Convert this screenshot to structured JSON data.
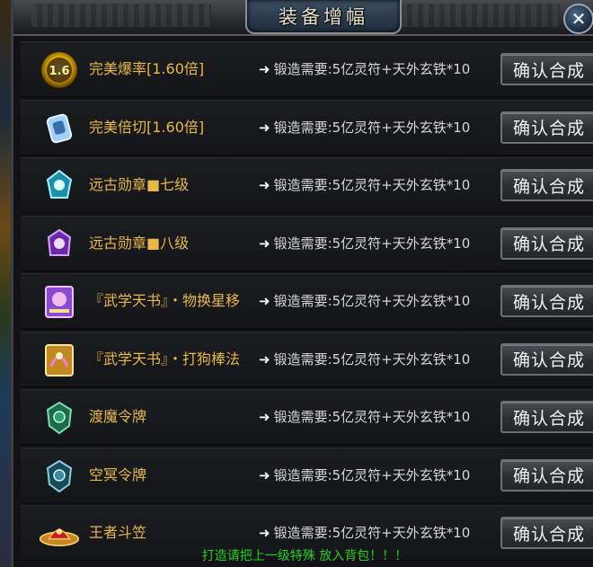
{
  "window": {
    "title": "装备增幅",
    "close_label": "✕"
  },
  "items": [
    {
      "name": "完美爆率[1.60倍]",
      "icon": "golden-badge-1.6-icon",
      "badge": "1.6",
      "requirement": "锻造需要:5亿灵符+天外玄铁*10",
      "button": "确认合成"
    },
    {
      "name": "完美倍切[1.60倍]",
      "icon": "blue-charm-icon",
      "requirement": "锻造需要:5亿灵符+天外玄铁*10",
      "button": "确认合成"
    },
    {
      "name": "远古勋章■七级",
      "icon": "cyan-medal-icon",
      "requirement": "锻造需要:5亿灵符+天外玄铁*10",
      "button": "确认合成"
    },
    {
      "name": "远古勋章■八级",
      "icon": "purple-medal-icon",
      "requirement": "锻造需要:5亿灵符+天外玄铁*10",
      "button": "确认合成"
    },
    {
      "name": "『武学天书』・物换星移",
      "icon": "purple-book-icon",
      "requirement": "锻造需要:5亿灵符+天外玄铁*10",
      "button": "确认合成"
    },
    {
      "name": "『武学天书』・打狗棒法",
      "icon": "golden-dragon-book-icon",
      "requirement": "锻造需要:5亿灵符+天外玄铁*10",
      "button": "确认合成"
    },
    {
      "name": "渡魔令牌",
      "icon": "green-token-icon",
      "requirement": "锻造需要:5亿灵符+天外玄铁*10",
      "button": "确认合成"
    },
    {
      "name": "空冥令牌",
      "icon": "teal-token-icon",
      "requirement": "锻造需要:5亿灵符+天外玄铁*10",
      "button": "确认合成"
    },
    {
      "name": "王者斗笠",
      "icon": "red-hat-icon",
      "requirement": "锻造需要:5亿灵符+天外玄铁*10",
      "button": "确认合成"
    }
  ],
  "footer": "打造请把上一级特殊 放入背包！！！",
  "colors": {
    "item_name": "#e8b84a",
    "requirement": "#d6d6d6",
    "footer": "#22d022",
    "title": "#e8e2d0"
  }
}
